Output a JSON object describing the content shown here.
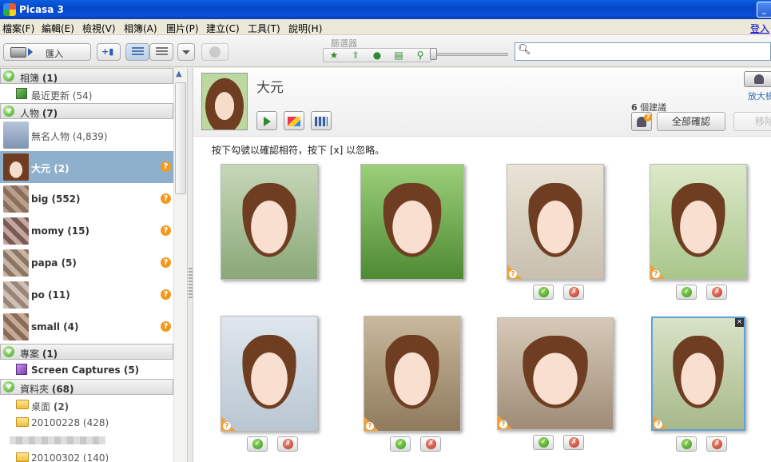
{
  "window": {
    "title": "Picasa 3"
  },
  "menu": {
    "items": [
      "檔案(F)",
      "編輯(E)",
      "檢視(V)",
      "相簿(A)",
      "圖片(P)",
      "建立(C)",
      "工具(T)",
      "說明(H)"
    ],
    "login": "登入"
  },
  "toolbar": {
    "import_label": "匯入",
    "filters_label": "篩選器",
    "filter_icons": [
      "star-icon",
      "upload-icon",
      "person-icon",
      "movie-icon",
      "pin-icon"
    ],
    "search_value": ""
  },
  "sidebar": {
    "albums": {
      "label": "相簿",
      "count": "(1)"
    },
    "recent": {
      "label": "最近更新",
      "count": "(54)"
    },
    "people": {
      "label": "人物",
      "count": "(7)"
    },
    "unnamed": {
      "label": "無名人物",
      "count": "(4,839)"
    },
    "persons": [
      {
        "name": "大元",
        "count": "(2)"
      },
      {
        "name": "big",
        "count": "(552)"
      },
      {
        "name": "momy",
        "count": "(15)"
      },
      {
        "name": "papa",
        "count": "(5)"
      },
      {
        "name": "po",
        "count": "(11)"
      },
      {
        "name": "small",
        "count": "(4)"
      }
    ],
    "projects": {
      "label": "專案",
      "count": "(1)"
    },
    "screen_captures": {
      "label": "Screen Captures",
      "count": "(5)"
    },
    "folders": {
      "label": "資料夾",
      "count": "(68)"
    },
    "folder_items": [
      {
        "name": "桌面",
        "count": "(2)"
      },
      {
        "name": "20100228",
        "count": "(428)"
      },
      {
        "name": "20100302",
        "count": "(140)"
      }
    ]
  },
  "main": {
    "person_name": "大元",
    "suggestions_count": "6",
    "suggestions_label": "個建議",
    "confirm_all": "全部確認",
    "remove": "移除",
    "zoom_label": "放大檢",
    "instructions": "按下勾號以確認相符，按下 [x] 以忽略。",
    "ok_glyph": "✓",
    "no_glyph": "✗",
    "question_glyph": "?",
    "close_glyph": "×"
  },
  "colors": {
    "selected_row": "#8fb0cd",
    "accent_green": "#2f8d16",
    "accent_red": "#b42a16",
    "badge_orange": "#f39a1d",
    "titlebar_blue": "#0547c9"
  }
}
